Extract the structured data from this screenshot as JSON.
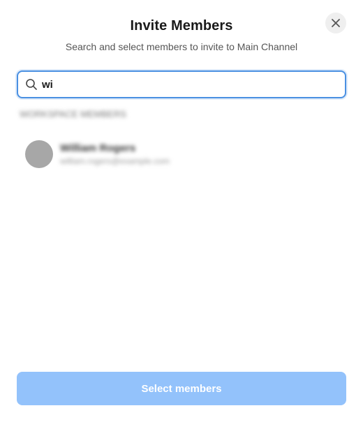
{
  "dialog": {
    "title": "Invite Members",
    "subtitle": "Search and select members to invite to Main Channel",
    "close_icon": "close-icon"
  },
  "search": {
    "value": "wi",
    "placeholder": "",
    "icon": "search-icon",
    "accent_color": "#4a90e2"
  },
  "results": {
    "section_label": "WORKSPACE MEMBERS",
    "members": [
      {
        "name": "William Rogers",
        "email": "william.rogers@example.com",
        "avatar_color": "#a7a7a7"
      }
    ]
  },
  "footer": {
    "submit_label": "Select members",
    "submit_color": "#93c2fb"
  }
}
